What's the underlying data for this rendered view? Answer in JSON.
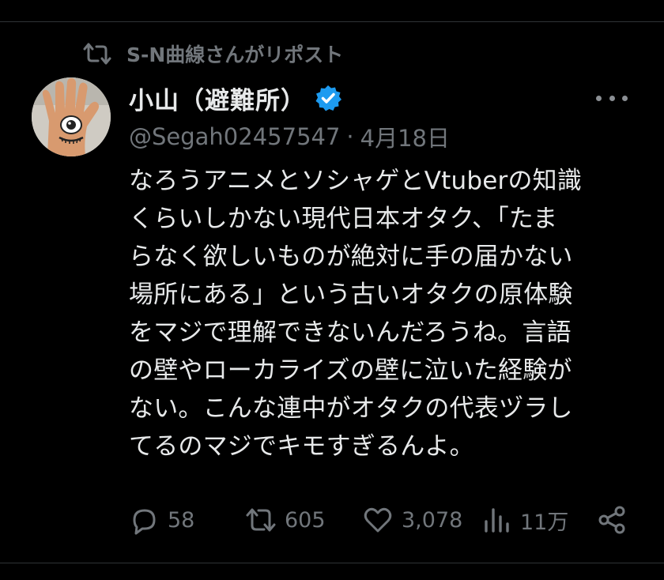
{
  "repost_banner": {
    "icon": "repost-icon",
    "text": "S-N曲線さんがリポスト"
  },
  "author": {
    "avatar_icon": "hand-eye-avatar",
    "display_name": "小山（避難所）",
    "verified_icon": "verified-badge-icon",
    "verified_color": "#1d9bf0",
    "handle": "@Segah02457547",
    "separator": "·",
    "date": "4月18日"
  },
  "more_icon": "more-options-icon",
  "tweet": {
    "text": "なろうアニメとソシャゲとVtuberの知識\nくらいしかない現代日本オタク、「たま\nらなく欲しいものが絶対に手の届かない\n場所にある」という古いオタクの原体験\nをマジで理解できないんだろうね。言語\nの壁やローカライズの壁に泣いた経験が\nない。こんな連中がオタクの代表ヅラし\nてるのマジでキモすぎるんよ。"
  },
  "actions": {
    "reply": {
      "icon": "reply-icon",
      "count": "58"
    },
    "repost": {
      "icon": "repost-icon",
      "count": "605"
    },
    "like": {
      "icon": "like-icon",
      "count": "3,078"
    },
    "views": {
      "icon": "views-icon",
      "count": "11万"
    },
    "share": {
      "icon": "share-icon"
    }
  },
  "colors": {
    "background": "#000000",
    "primary_text": "#e7e9ea",
    "secondary_text": "#71767b",
    "divider": "#2f3336"
  }
}
